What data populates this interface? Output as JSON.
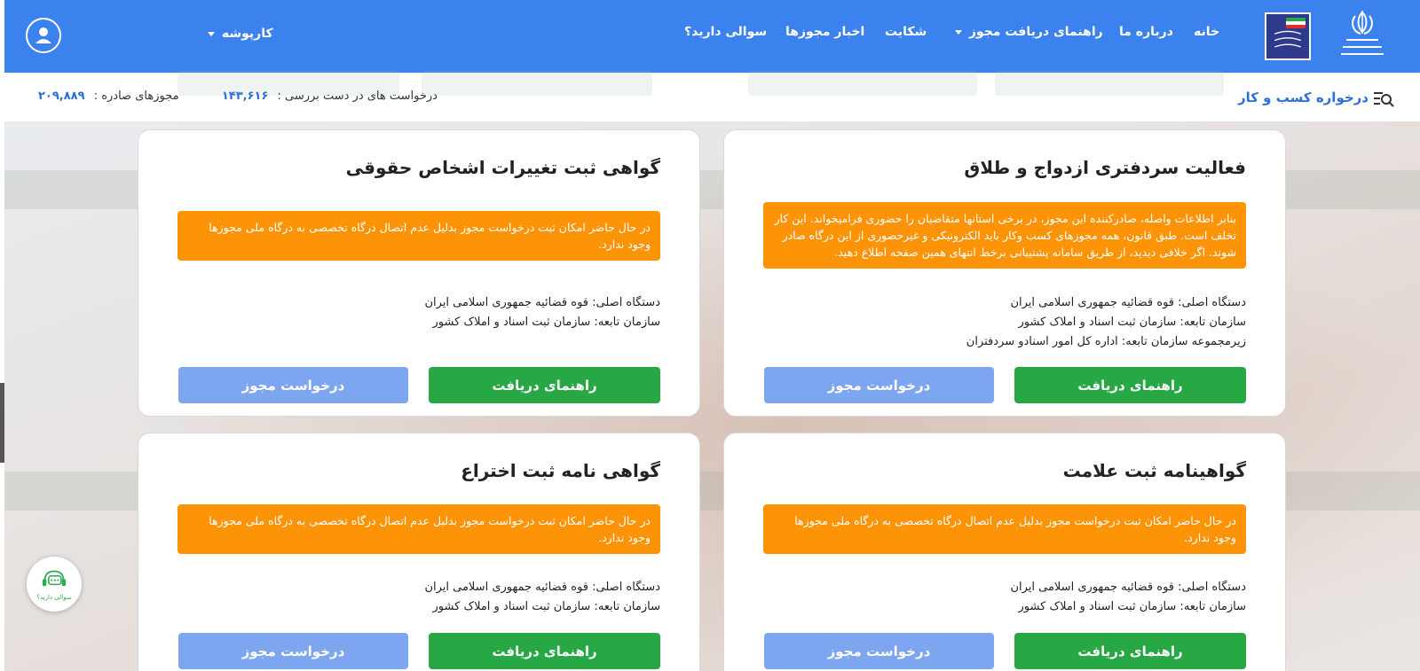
{
  "header": {
    "cart_label": "کارپوشه",
    "nav": {
      "home": "خانه",
      "about": "درباره ما",
      "guide": "راهنمای دریافت مجوز",
      "complaint": "شکایت",
      "news": "اخبار مجوزها",
      "faq": "سوالی دارید؟"
    }
  },
  "subheader": {
    "brand": "درخواره کسب و کار",
    "pending_label": "درخواست های در دست بررسی :",
    "pending_count": "۱۴۳,۶۱۶",
    "issued_label": "مجوزهای صادره :",
    "issued_count": "۲۰۹,۸۸۹"
  },
  "cards": [
    {
      "title": "فعالیت سردفتری ازدواج و طلاق",
      "alert": "بنابر اطلاعات واصله، صادرکننده این مجوز، در برخی استانها متقاضیان را حضوری فرامیخواند. این کار تخلف است. طبق قانون، همه مجوزهای کسب وکار باید الکترونیکی و غیرحضوری از این درگاه صادر شوند. اگر خلافی دیدید، از طریق سامانه پشتیبانی برخط انتهای همین صفحه اطلاع دهید.",
      "main_org": "دستگاه اصلی: قوه قضائیه جمهوری اسلامی ایران",
      "sub_org": "سازمان تابعه: سازمان ثبت اسناد و املاک کشور",
      "sub_unit": "زیرمجموعه سازمان تابعه: اداره کل امور اسنادو سردفتران",
      "guide_label": "راهنمای دریافت",
      "request_label": "درخواست مجوز"
    },
    {
      "title": "گواهی ثبت تغییرات اشخاص حقوقی",
      "alert": "در حال حاضر امکان ثبت درخواست مجوز بدلیل عدم اتصال درگاه تخصصی به درگاه ملی مجوزها وجود ندارد.",
      "main_org": "دستگاه اصلی: قوه قضائیه جمهوری اسلامی ایران",
      "sub_org": "سازمان تابعه: سازمان ثبت اسناد و املاک کشور",
      "guide_label": "راهنمای دریافت",
      "request_label": "درخواست مجوز"
    },
    {
      "title": "گواهینامه ثبت علامت",
      "alert": "در حال حاضر امکان ثبت درخواست مجوز بدلیل عدم اتصال درگاه تخصصی به درگاه ملی مجوزها وجود ندارد.",
      "main_org": "دستگاه اصلی: قوه قضائیه جمهوری اسلامی ایران",
      "sub_org": "سازمان تابعه: سازمان ثبت اسناد و املاک کشور",
      "guide_label": "راهنمای دریافت",
      "request_label": "درخواست مجوز"
    },
    {
      "title": "گواهی نامه ثبت اختراع",
      "alert": "در حال حاضر امکان ثبت درخواست مجوز بدلیل عدم اتصال درگاه تخصصی به درگاه ملی مجوزها وجود ندارد.",
      "main_org": "دستگاه اصلی: قوه قضائیه جمهوری اسلامی ایران",
      "sub_org": "سازمان تابعه: سازمان ثبت اسناد و املاک کشور",
      "guide_label": "راهنمای دریافت",
      "request_label": "درخواست مجوز"
    }
  ],
  "chat": {
    "label": "سوالی دارید؟"
  },
  "icons": {
    "avatar": "user-circle-icon",
    "search": "search-list-icon",
    "chat": "support-chat-icon"
  },
  "colors": {
    "header": "#3b82ee",
    "alert": "#fd9408",
    "guide_button": "#28a745",
    "request_button": "#7ea6f0",
    "stat_number": "#2e6fd8"
  }
}
